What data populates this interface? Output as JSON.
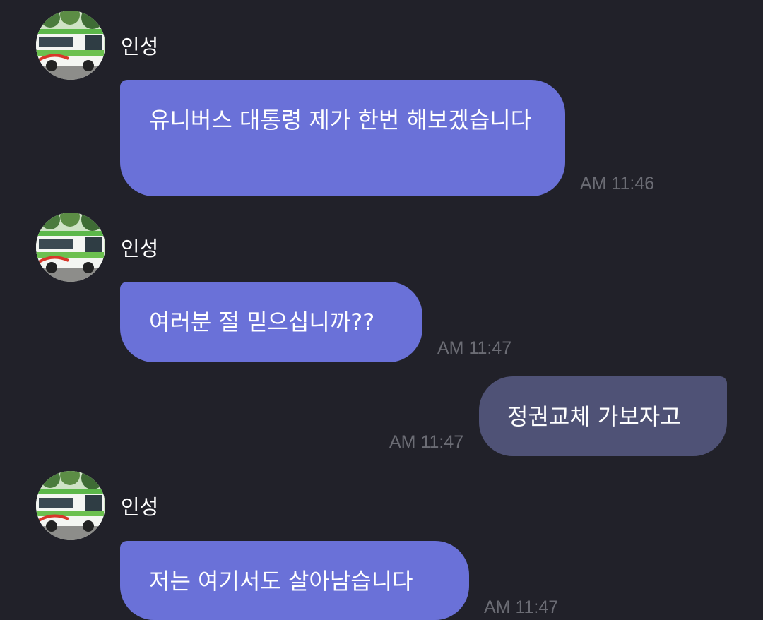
{
  "messages": [
    {
      "sender": "인성",
      "text": "유니버스 대통령 제가 한번 해보겠습니다",
      "time": "AM 11:46",
      "direction": "incoming"
    },
    {
      "sender": "인성",
      "text": "여러분 절 믿으십니까??",
      "time": "AM 11:47",
      "direction": "incoming"
    },
    {
      "sender": "",
      "text": "정권교체 가보자고",
      "time": "AM 11:47",
      "direction": "outgoing"
    },
    {
      "sender": "인성",
      "text": "저는 여기서도 살아남습니다",
      "time": "AM 11:47",
      "direction": "incoming"
    }
  ],
  "avatar_icon": "bus-photo-avatar",
  "colors": {
    "background": "#212129",
    "incoming_bubble": "#6a71d8",
    "outgoing_bubble": "#4f5276",
    "timestamp": "#6b6c74"
  }
}
